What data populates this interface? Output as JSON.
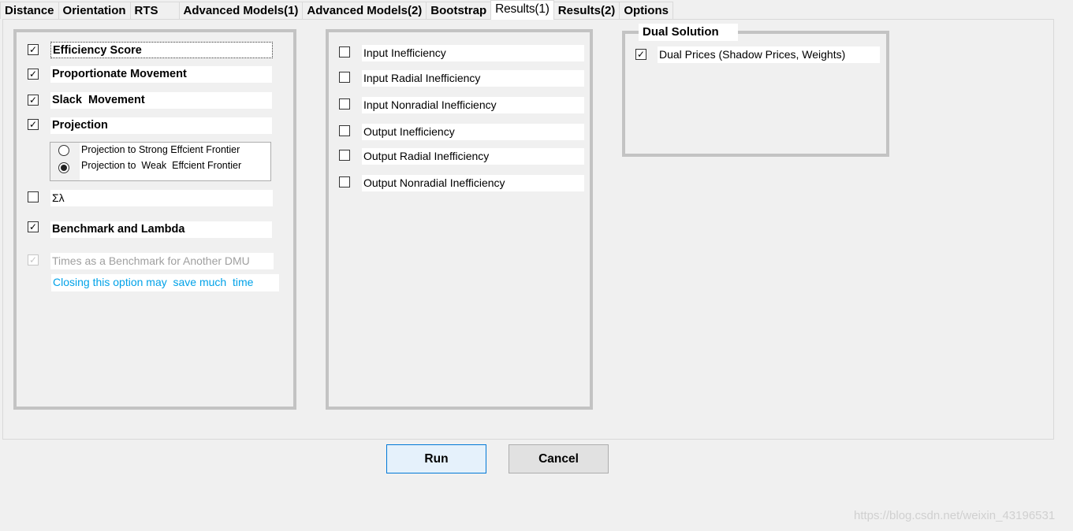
{
  "tabs": [
    {
      "label": "Distance",
      "active": false
    },
    {
      "label": "Orientation",
      "active": false
    },
    {
      "label": "RTS",
      "active": false
    },
    {
      "label": "Advanced Models(1)",
      "active": false
    },
    {
      "label": "Advanced Models(2)",
      "active": false
    },
    {
      "label": "Bootstrap",
      "active": false
    },
    {
      "label": "Results(1)",
      "active": true
    },
    {
      "label": "Results(2)",
      "active": false
    },
    {
      "label": "Options",
      "active": false
    }
  ],
  "left": {
    "efficiency_score": {
      "label": "Efficiency Score",
      "checked": true
    },
    "proportionate": {
      "label": "Proportionate Movement",
      "checked": true
    },
    "slack": {
      "label": "Slack  Movement",
      "checked": true
    },
    "projection": {
      "label": "Projection",
      "checked": true
    },
    "radio_strong": {
      "label": "Projection to Strong Effcient Frontier",
      "selected": false
    },
    "radio_weak": {
      "label": "Projection to  Weak  Effcient Frontier",
      "selected": true
    },
    "sum_lambda": {
      "label": "Σλ",
      "checked": false
    },
    "benchmark": {
      "label": "Benchmark and Lambda",
      "checked": true
    },
    "times": {
      "label": "Times as a Benchmark for Another DMU",
      "checked": true,
      "disabled": true
    },
    "note": "Closing this option may  save much  time",
    "note_color": "#00a2e8"
  },
  "middle": {
    "items": [
      {
        "label": "Input Inefficiency",
        "checked": false
      },
      {
        "label": "Input Radial Inefficiency",
        "checked": false
      },
      {
        "label": "Input Nonradial Inefficiency",
        "checked": false
      },
      {
        "label": "Output Inefficiency",
        "checked": false
      },
      {
        "label": "Output Radial Inefficiency",
        "checked": false
      },
      {
        "label": "Output Nonradial Inefficiency",
        "checked": false
      }
    ]
  },
  "right": {
    "title": "Dual Solution",
    "dual_prices": {
      "label": "Dual Prices (Shadow Prices, Weights)",
      "checked": true
    }
  },
  "buttons": {
    "run": "Run",
    "cancel": "Cancel"
  },
  "watermark": "https://blog.csdn.net/weixin_43196531"
}
